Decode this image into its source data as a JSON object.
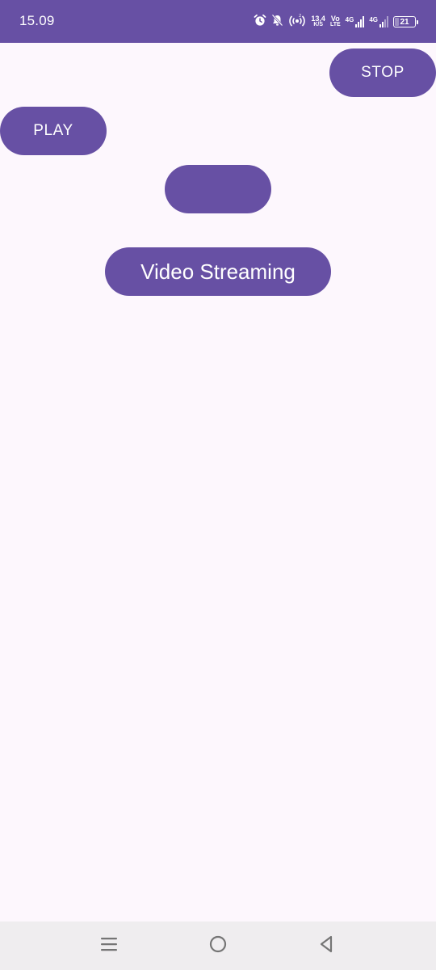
{
  "status_bar": {
    "time": "15.09",
    "net_speed_value": "13,4",
    "net_speed_unit": "K/S",
    "volte_top": "Vo",
    "volte_bottom": "LTE",
    "sim1_network": "4G",
    "sim2_network": "4G",
    "battery_level": "21",
    "background": "#6750a4",
    "icons": [
      "alarm-icon",
      "bell-muted-icon",
      "hotspot-icon",
      "signal-icon",
      "battery-icon"
    ]
  },
  "buttons": {
    "stop_label": "STOP",
    "play_label": "PLAY",
    "blank_label": "",
    "video_streaming_label": "Video Streaming"
  },
  "navigation": {
    "icons": [
      "recents-icon",
      "home-icon",
      "back-icon"
    ]
  },
  "colors": {
    "accent": "#6750a4",
    "background": "#fdf7fd",
    "nav_background": "#efedef",
    "nav_icon": "#757575"
  }
}
